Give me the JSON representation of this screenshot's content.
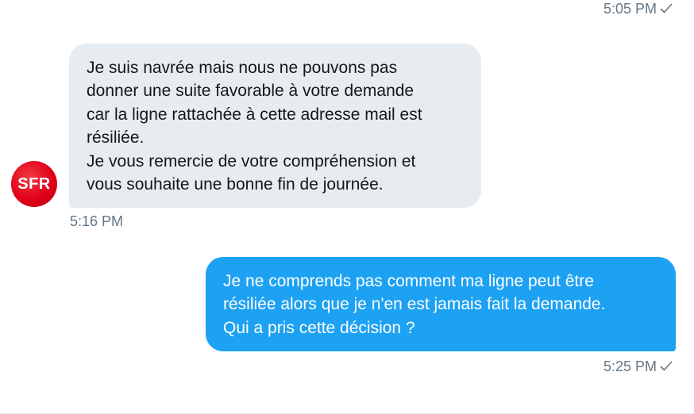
{
  "messages": [
    {
      "direction": "outgoing",
      "timestamp": "5:05 PM",
      "read_receipt_icon": "checkmark-icon"
    },
    {
      "direction": "incoming",
      "sender_avatar_text": "SFR",
      "avatar_color": "#e1001a",
      "bubble_color": "#e6ecf0",
      "lines": [
        "Je suis navrée mais nous ne pouvons pas",
        "donner une suite favorable à votre demande",
        "car la ligne rattachée à cette adresse mail est",
        "résiliée.",
        "Je vous remercie de votre compréhension et",
        "vous souhaite une bonne fin de journée."
      ],
      "timestamp": "5:16 PM"
    },
    {
      "direction": "outgoing",
      "bubble_color": "#1da1f2",
      "lines": [
        "Je ne comprends pas comment ma ligne peut être",
        "résiliée alors que je n'en est jamais fait la demande.",
        "Qui a pris cette décision ?"
      ],
      "timestamp": "5:25 PM",
      "read_receipt_icon": "checkmark-icon"
    }
  ]
}
